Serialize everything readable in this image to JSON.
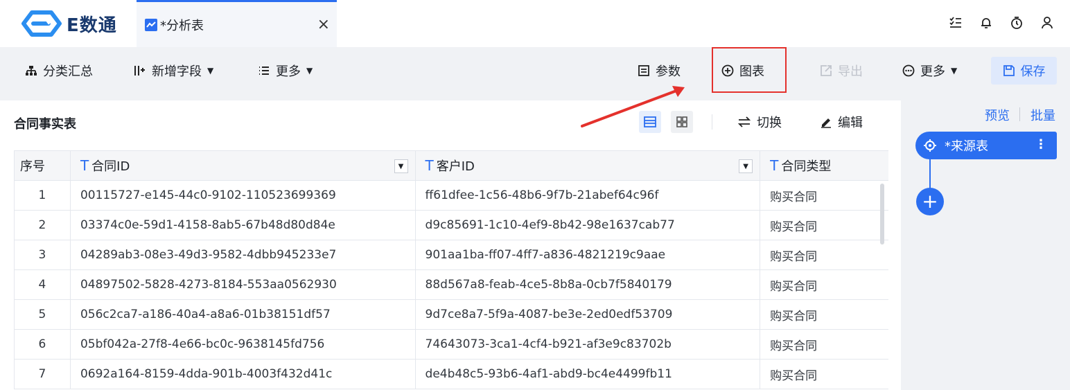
{
  "app": {
    "logo_text": "E数通"
  },
  "tab": {
    "label": "*分析表",
    "close": "×"
  },
  "top_icons": [
    "list-check-icon",
    "bell-icon",
    "timer-icon",
    "user-icon"
  ],
  "toolbar": {
    "group_summary": "分类汇总",
    "add_field": "新增字段",
    "more_left": "更多",
    "params": "参数",
    "chart": "图表",
    "export": "导出",
    "more_right": "更多",
    "save": "保存"
  },
  "main": {
    "table_title": "合同事实表",
    "switch": "切换",
    "edit": "编辑",
    "columns": [
      "序号",
      "合同ID",
      "客户ID",
      "合同类型"
    ],
    "rows": [
      [
        "1",
        "00115727-e145-44c0-9102-110523699369",
        "ff61dfee-1c56-48b6-9f7b-21abef64c96f",
        "购买合同"
      ],
      [
        "2",
        "03374c0e-59d1-4158-8ab5-67b48d80d84e",
        "d9c85691-1c10-4ef9-8b42-98e1637cab77",
        "购买合同"
      ],
      [
        "3",
        "04289ab3-08e3-49d3-9582-4dbb945233e7",
        "901aa1ba-ff07-4ff7-a836-4821219c9aae",
        "购买合同"
      ],
      [
        "4",
        "04897502-5828-4273-8184-553aa0562930",
        "88d567a8-feab-4ce5-8b8a-0cb7f5840179",
        "购买合同"
      ],
      [
        "5",
        "056c2ca7-a186-40a4-a8a6-01b38151df57",
        "9d7ce8a7-5f9a-4087-be3e-2ed0edf53709",
        "购买合同"
      ],
      [
        "6",
        "05bf042a-27f8-4e66-bc0c-9638145fd756",
        "74643073-3ca1-4cf4-b921-af3e9c83702b",
        "购买合同"
      ],
      [
        "7",
        "0692a164-8159-4dda-901b-4003f432d41c",
        "de4b48c5-93b6-4af1-abd9-bc4e4499fb11",
        "购买合同"
      ]
    ]
  },
  "side": {
    "preview": "预览",
    "batch": "批量",
    "source_node": "*来源表",
    "add": "+"
  },
  "colors": {
    "accent": "#2b6ef0",
    "highlight": "#e4312c"
  }
}
